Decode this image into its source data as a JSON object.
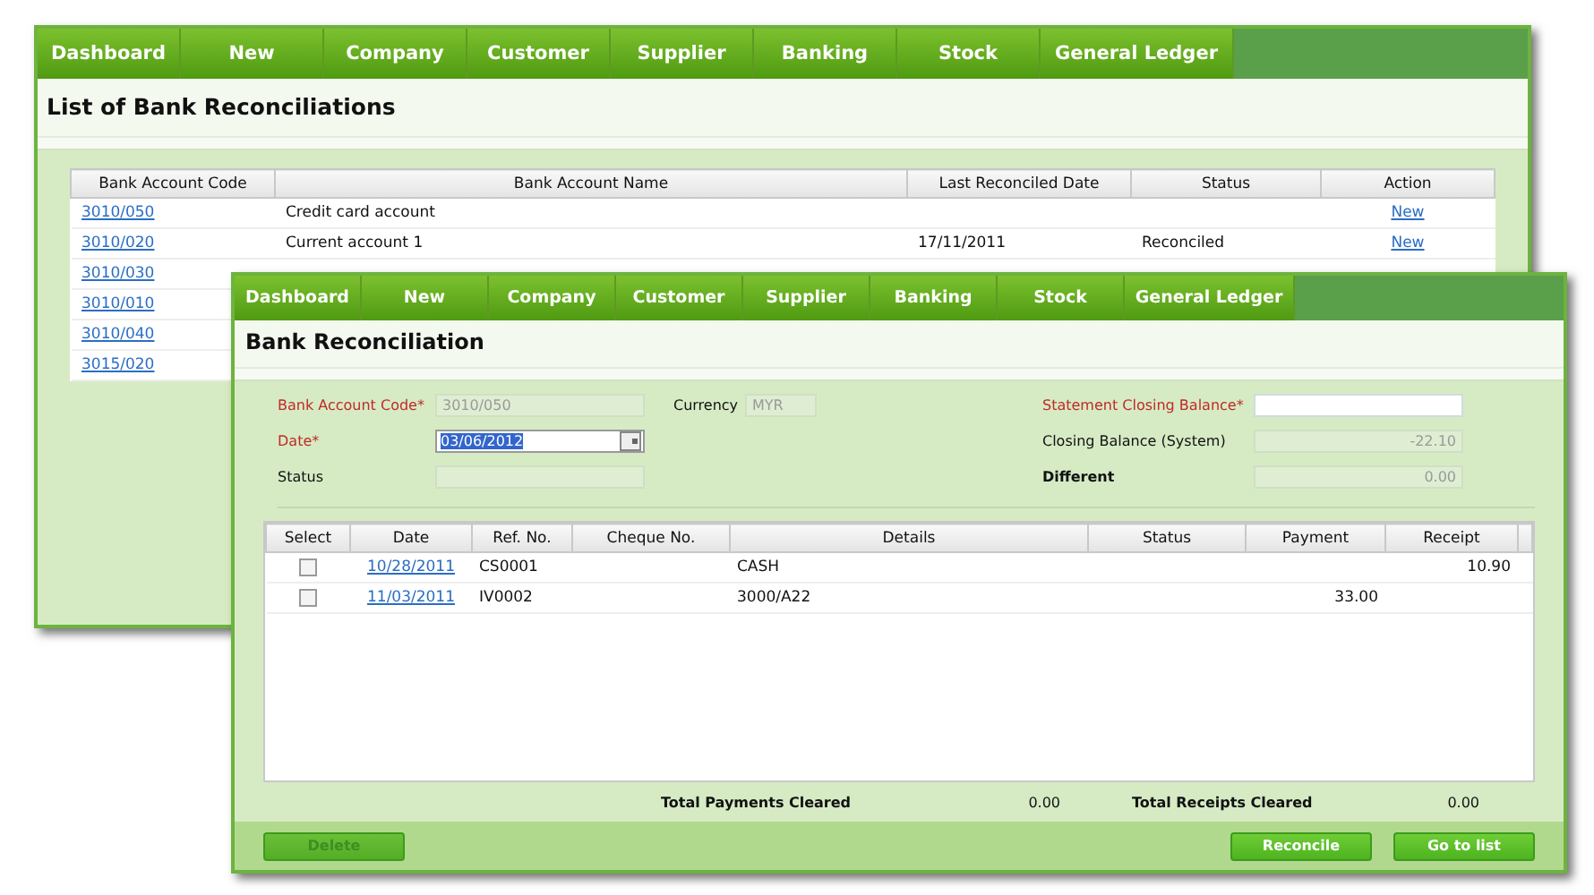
{
  "back_window": {
    "nav": [
      {
        "label": "Dashboard",
        "selected": false
      },
      {
        "label": "New",
        "selected": false
      },
      {
        "label": "Company",
        "selected": false
      },
      {
        "label": "Customer",
        "selected": false
      },
      {
        "label": "Supplier",
        "selected": false
      },
      {
        "label": "Banking",
        "selected": false
      },
      {
        "label": "Stock",
        "selected": false
      },
      {
        "label": "General Ledger",
        "selected": false
      }
    ],
    "title": "List of Bank Reconciliations",
    "table": {
      "columns": [
        "Bank Account Code",
        "Bank Account Name",
        "Last Reconciled Date",
        "Status",
        "Action"
      ],
      "rows": [
        {
          "code": "3010/050",
          "name": "Credit card account",
          "date": "",
          "status": "",
          "action": "New"
        },
        {
          "code": "3010/020",
          "name": "Current account 1",
          "date": "17/11/2011",
          "status": "Reconciled",
          "action": "New"
        },
        {
          "code": "3010/030"
        },
        {
          "code": "3010/010"
        },
        {
          "code": "3010/040"
        },
        {
          "code": "3015/020"
        }
      ]
    }
  },
  "front_window": {
    "nav": [
      {
        "label": "Dashboard",
        "selected": false
      },
      {
        "label": "New",
        "selected": false
      },
      {
        "label": "Company",
        "selected": false
      },
      {
        "label": "Customer",
        "selected": false
      },
      {
        "label": "Supplier",
        "selected": false
      },
      {
        "label": "Banking",
        "selected": false
      },
      {
        "label": "Stock",
        "selected": false
      },
      {
        "label": "General Ledger",
        "selected": false
      }
    ],
    "title": "Bank Reconciliation",
    "form": {
      "bank_account_code": {
        "label": "Bank Account Code*",
        "value": "3010/050",
        "required": true,
        "disabled": true
      },
      "currency": {
        "label": "Currency",
        "value": "MYR",
        "required": false,
        "disabled": true
      },
      "date": {
        "label": "Date*",
        "value": "03/06/2012",
        "required": true,
        "disabled": false
      },
      "status": {
        "label": "Status",
        "required": false,
        "disabled": true
      },
      "statement_closing_balance": {
        "label": "Statement Closing Balance*",
        "required": true,
        "disabled": false
      },
      "closing_balance_system": {
        "label": "Closing Balance (System)",
        "value": "-22.10",
        "required": false,
        "disabled": true
      },
      "different": {
        "label": "Different",
        "value": "0.00",
        "required": false,
        "disabled": true
      }
    },
    "table": {
      "columns": [
        "Select",
        "Date",
        "Ref. No.",
        "Cheque No.",
        "Details",
        "Status",
        "Payment",
        "Receipt"
      ],
      "rows": [
        {
          "checked": false,
          "date": "10/28/2011",
          "ref": "CS0001",
          "cheque": "",
          "details": "CASH",
          "status": "",
          "payment": "",
          "receipt": "10.90"
        },
        {
          "checked": false,
          "date": "11/03/2011",
          "ref": "IV0002",
          "cheque": "",
          "details": "3000/A22",
          "status": "",
          "payment": "33.00",
          "receipt": ""
        }
      ]
    },
    "totals": [
      {
        "label": "Total Payments Cleared",
        "value": "0.00"
      },
      {
        "label": "Total Receipts Cleared",
        "value": "0.00"
      }
    ],
    "buttons": [
      {
        "label": "Delete",
        "disabled": true
      },
      {
        "label": "Reconcile",
        "disabled": false
      },
      {
        "label": "Go to list",
        "disabled": false
      }
    ]
  }
}
